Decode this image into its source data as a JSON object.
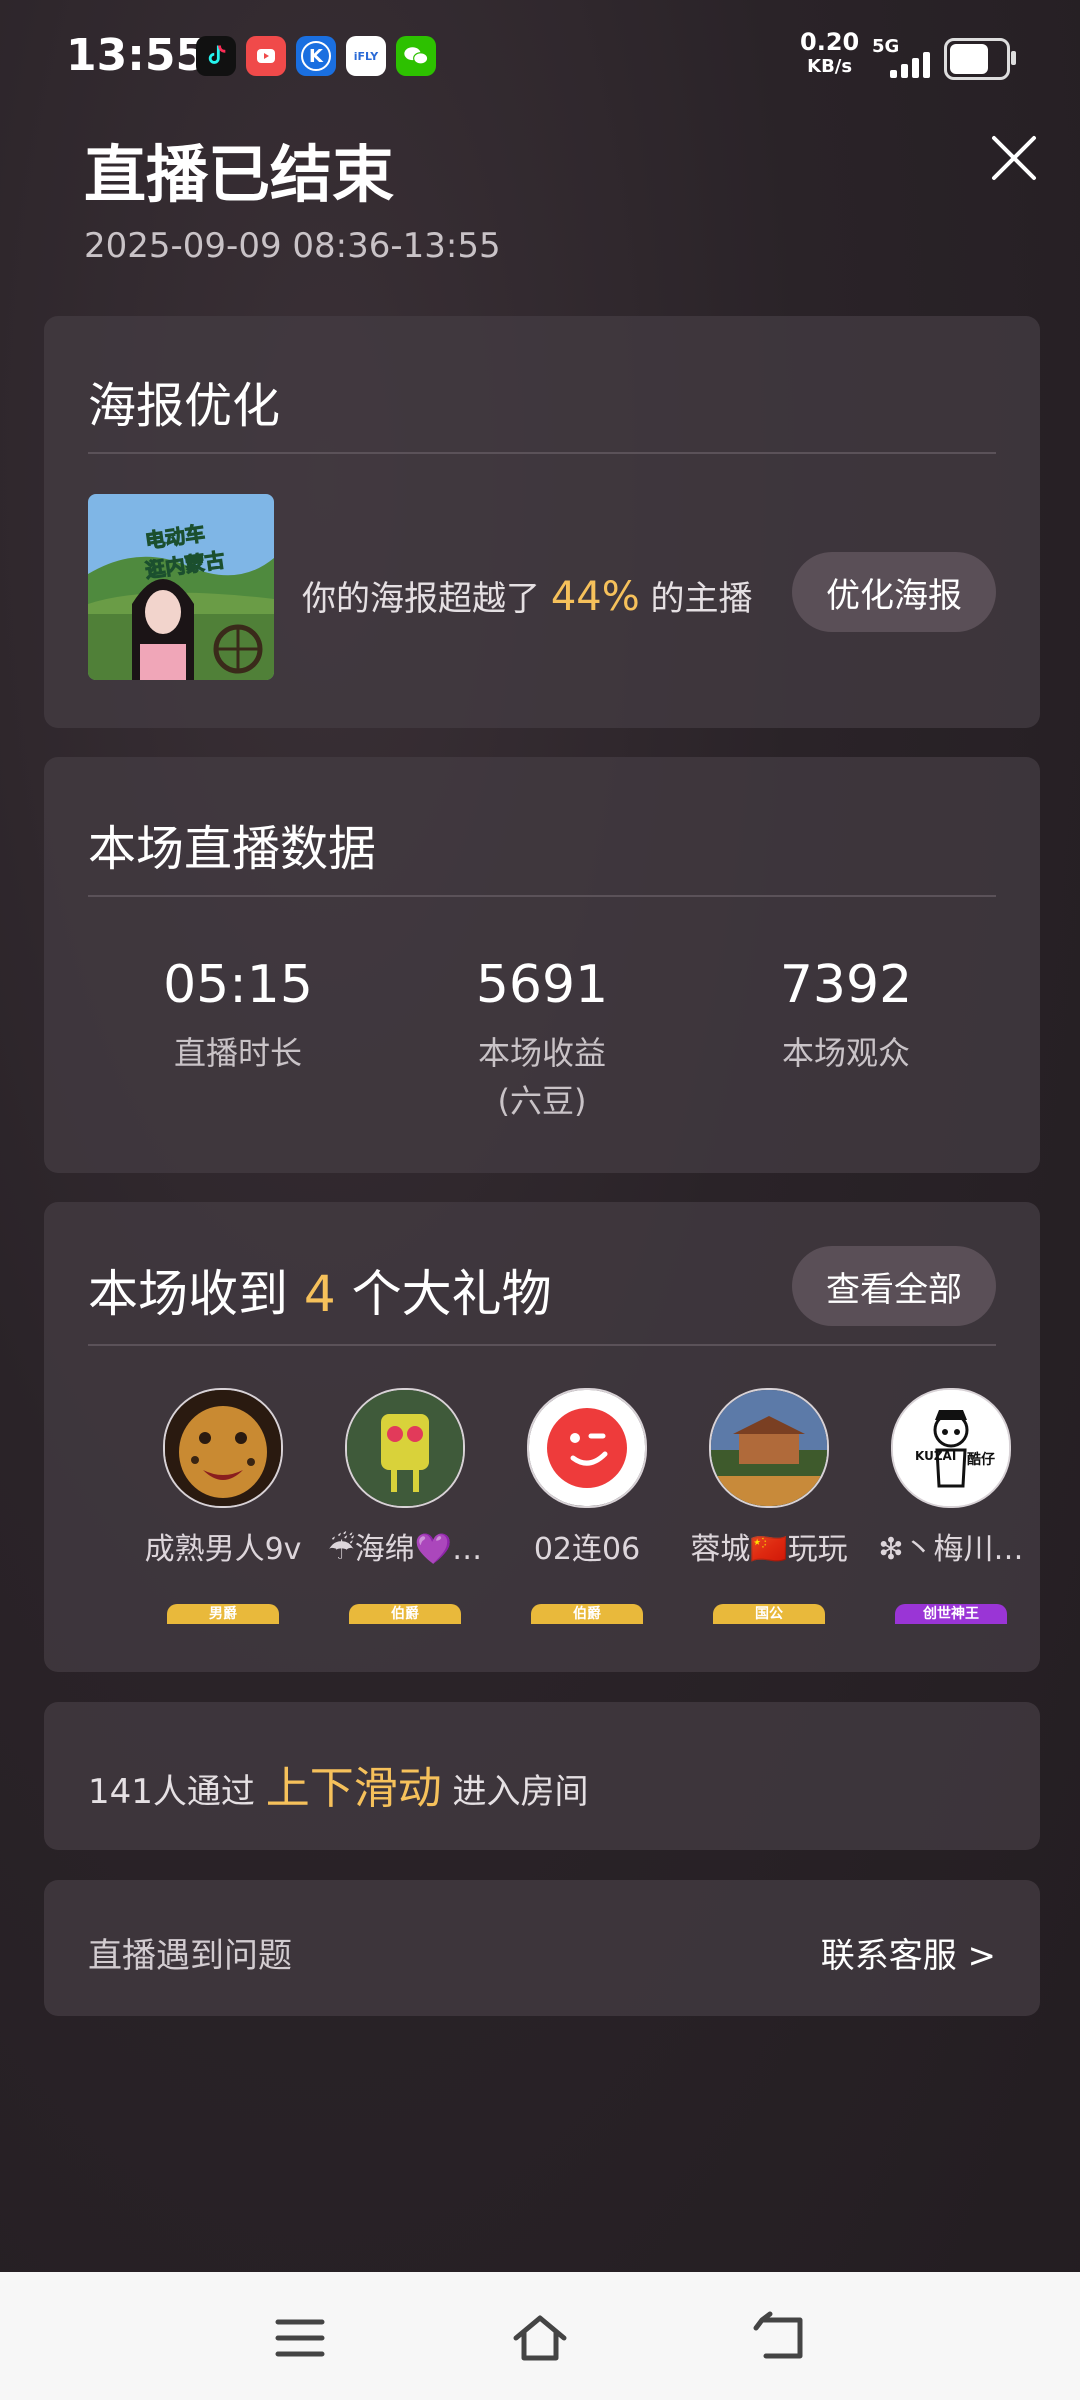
{
  "status_bar": {
    "time": "13:55",
    "net_speed": "0.20",
    "net_unit": "KB/s",
    "network_type": "5G",
    "app_icons": [
      "tiktok-icon",
      "video-app-icon",
      "k-app-icon",
      "ifly-icon",
      "wechat-icon"
    ],
    "app_icon_texts": [
      "",
      "",
      "K",
      "iFLY",
      ""
    ]
  },
  "header": {
    "title": "直播已结束",
    "time_range": "2025-09-09 08:36-13:55"
  },
  "poster_card": {
    "title": "海报优化",
    "image_caption_line1": "电动车",
    "image_caption_line2": "逛内蒙古",
    "text_prefix": "你的海报超越了",
    "percent": "44%",
    "text_suffix": "的主播",
    "button_label": "优化海报"
  },
  "stats_card": {
    "title": "本场直播数据",
    "items": [
      {
        "value": "05:15",
        "label": "直播时长",
        "sub": ""
      },
      {
        "value": "5691",
        "label": "本场收益",
        "sub": "(六豆)"
      },
      {
        "value": "7392",
        "label": "本场观众",
        "sub": ""
      }
    ]
  },
  "gifts_card": {
    "title_prefix": "本场收到",
    "count": "4",
    "title_suffix": "个大礼物",
    "view_all_label": "查看全部",
    "gifters": [
      {
        "name": "成熟男人9v",
        "badge": "男爵"
      },
      {
        "name": "☔海绵💜…",
        "badge": "伯爵"
      },
      {
        "name": "02连06",
        "badge": "伯爵"
      },
      {
        "name": "蓉城🇨🇳玩玩",
        "badge": "国公"
      },
      {
        "name": "❇丶梅川…",
        "badge": "创世神王"
      }
    ],
    "avatar_text_kuzai": "KUZAI",
    "avatar_text_kuzai2": "酷仔"
  },
  "swipe_card": {
    "prefix": "141人通过",
    "highlight": "上下滑动",
    "suffix": "进入房间"
  },
  "problem_card": {
    "label": "直播遇到问题",
    "link": "联系客服 >"
  },
  "colors": {
    "accent": "#f6c15b",
    "card_bg": "#443c43",
    "pill_bg": "#5a4f57",
    "background": "#2a2328"
  }
}
